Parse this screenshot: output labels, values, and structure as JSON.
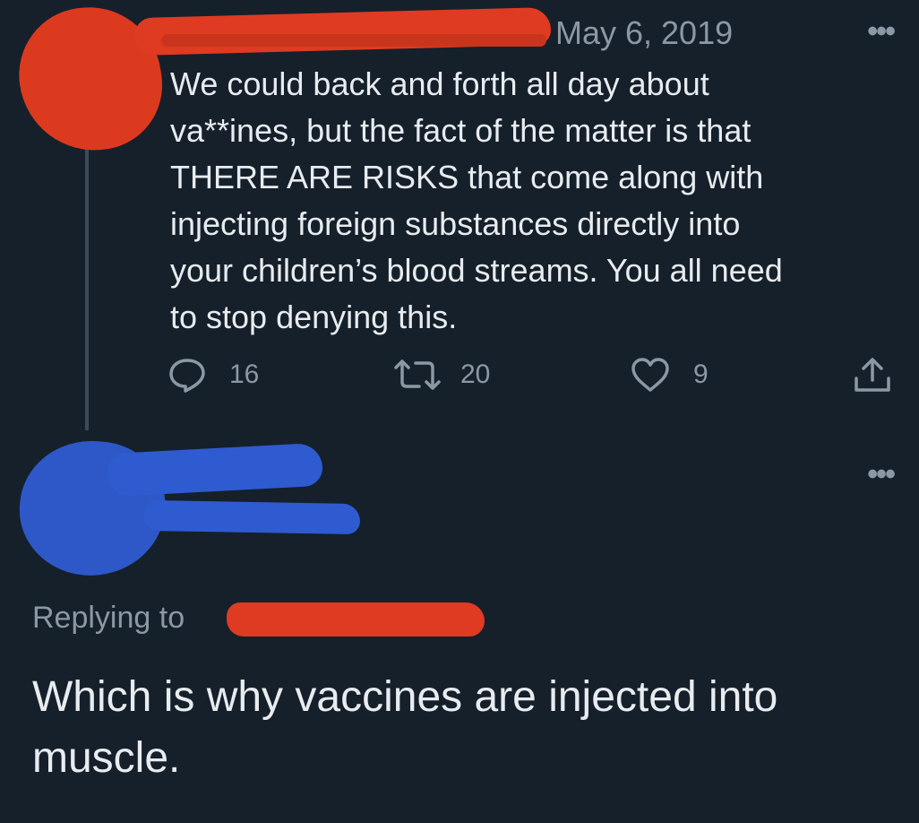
{
  "tweet": {
    "date": "May 6, 2019",
    "more_menu": "•••",
    "text": "We could back and forth all day about\nva**ines, but the fact of the matter is that\nTHERE ARE RISKS that come along with\ninjecting foreign substances directly into\nyour children’s blood streams. You all need\nto stop denying this.",
    "actions": {
      "reply_icon": "reply-icon",
      "reply_count": "16",
      "retweet_icon": "retweet-icon",
      "retweet_count": "20",
      "like_icon": "heart-icon",
      "like_count": "9",
      "share_icon": "share-icon"
    }
  },
  "reply": {
    "more_menu": "•••",
    "replying_to_label": "Replying to",
    "text": "Which is why vaccines are injected into muscle."
  },
  "colors": {
    "background": "#15202b",
    "text": "#e8ecef",
    "muted": "#8b98a5",
    "redaction_red": "#df3b22",
    "redaction_blue": "#2f5bd1"
  }
}
